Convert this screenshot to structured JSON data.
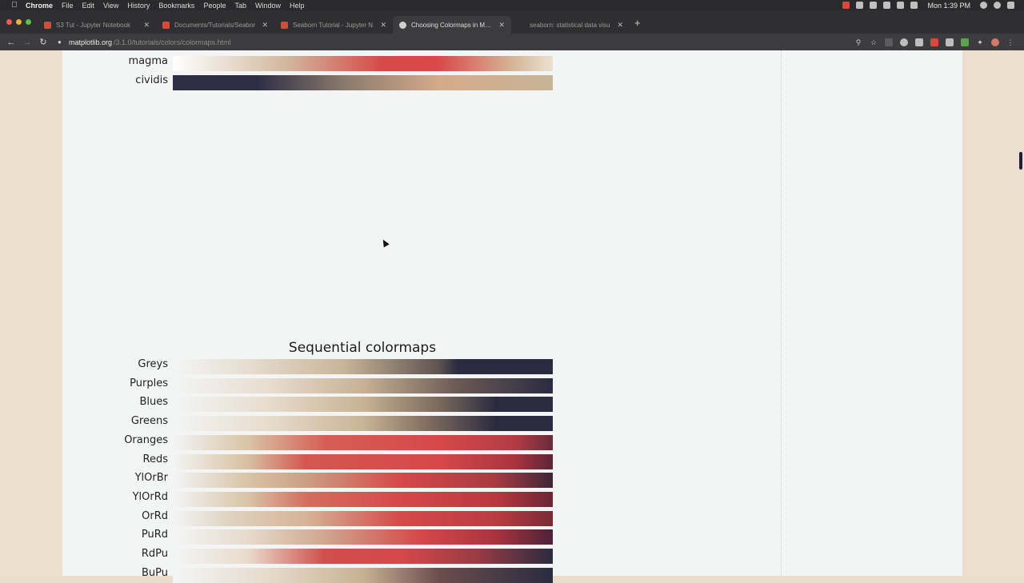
{
  "menubar": {
    "app": "Chrome",
    "items": [
      "File",
      "Edit",
      "View",
      "History",
      "Bookmarks",
      "People",
      "Tab",
      "Window",
      "Help"
    ],
    "clock": "Mon 1:39 PM"
  },
  "tabs": [
    {
      "title": "S3 Tut - Jupyter Notebook",
      "fav_color": "#d9473d",
      "active": false
    },
    {
      "title": "Documents/Tutorials/Seabor",
      "fav_color": "#d9473d",
      "active": false
    },
    {
      "title": "Seaborn Tutorial - Jupyter N",
      "fav_color": "#d9473d",
      "active": false
    },
    {
      "title": "Choosing Colormaps in Matpl",
      "fav_color": "#cfcfcf",
      "active": true
    },
    {
      "title": "seaborn: statistical data visu",
      "fav_color": "#2f2f31",
      "active": false
    }
  ],
  "address": {
    "domain": "matplotlib.org",
    "path": "/3.1.0/tutorials/colors/colormaps.html"
  },
  "figure_top": {
    "rows": [
      {
        "label": "magma",
        "stops": [
          "#ffffff 0%",
          "#efe8de 10%",
          "#d3b79d 30%",
          "#d64a48 55%",
          "#d94a48 70%",
          "#d6b89a 90%",
          "#ece0d2 100%"
        ]
      },
      {
        "label": "cividis",
        "stops": [
          "#2d2d45 0%",
          "#2d2d45 22%",
          "#8a7a6d 45%",
          "#d4aa8a 70%",
          "#c8b496 100%"
        ]
      }
    ]
  },
  "figure_sequential": {
    "title": "Sequential colormaps",
    "rows": [
      {
        "label": "Greys",
        "stops": [
          "#f3f5f5 0%",
          "#e6ddd0 20%",
          "#c8b597 45%",
          "#5d5350 70%",
          "#2a2a40 75%",
          "#2a2a40 100%"
        ]
      },
      {
        "label": "Purples",
        "stops": [
          "#f3f5f5 0%",
          "#e8ddd0 25%",
          "#c7b295 50%",
          "#6a5a55 75%",
          "#2b2b40 100%"
        ]
      },
      {
        "label": "Blues",
        "stops": [
          "#f3f5f5 0%",
          "#e7dccd 25%",
          "#c8b394 50%",
          "#7a6a5c 70%",
          "#2b2b40 85%",
          "#2b2b40 100%"
        ]
      },
      {
        "label": "Greens",
        "stops": [
          "#f3f5f5 0%",
          "#e7dccd 25%",
          "#c9b597 50%",
          "#8a7564 65%",
          "#2b2b40 85%",
          "#2b2b40 100%"
        ]
      },
      {
        "label": "Oranges",
        "stops": [
          "#f3f5f5 0%",
          "#d8c3a6 20%",
          "#d75e55 40%",
          "#d6484a 70%",
          "#b33c44 90%",
          "#6a2a3b 100%"
        ]
      },
      {
        "label": "Reds",
        "stops": [
          "#f3f5f5 0%",
          "#d7bf9f 20%",
          "#d35750 35%",
          "#d6484a 70%",
          "#a8353f 90%",
          "#5b2538 100%"
        ]
      },
      {
        "label": "YlOrBr",
        "stops": [
          "#f3f5f5 0%",
          "#d8c3a6 20%",
          "#cc9f84 35%",
          "#d6484a 60%",
          "#a73a43 85%",
          "#3f2638 100%"
        ]
      },
      {
        "label": "YlOrRd",
        "stops": [
          "#f3f5f5 0%",
          "#d8c3a6 20%",
          "#d46e60 35%",
          "#d6484a 60%",
          "#b9383f 85%",
          "#6b2635 100%"
        ]
      },
      {
        "label": "OrRd",
        "stops": [
          "#f3f5f5 0%",
          "#dfd2c0 15%",
          "#d6b497 35%",
          "#d6484a 60%",
          "#ba3c42 85%",
          "#7a2a36 100%"
        ]
      },
      {
        "label": "PuRd",
        "stops": [
          "#f3f5f5 0%",
          "#e6dacb 20%",
          "#cfa78d 40%",
          "#d6484a 65%",
          "#a8343f 85%",
          "#4b2236 100%"
        ]
      },
      {
        "label": "RdPu",
        "stops": [
          "#f3f5f5 0%",
          "#e8dbcb 20%",
          "#d04e4b 40%",
          "#d6484a 60%",
          "#9a3b44 80%",
          "#2b2b40 100%"
        ]
      },
      {
        "label": "BuPu",
        "stops": [
          "#f3f5f5 0%",
          "#e6dbcb 25%",
          "#c8b294 50%",
          "#6b4d4d 70%",
          "#2b2b40 100%"
        ]
      }
    ]
  }
}
